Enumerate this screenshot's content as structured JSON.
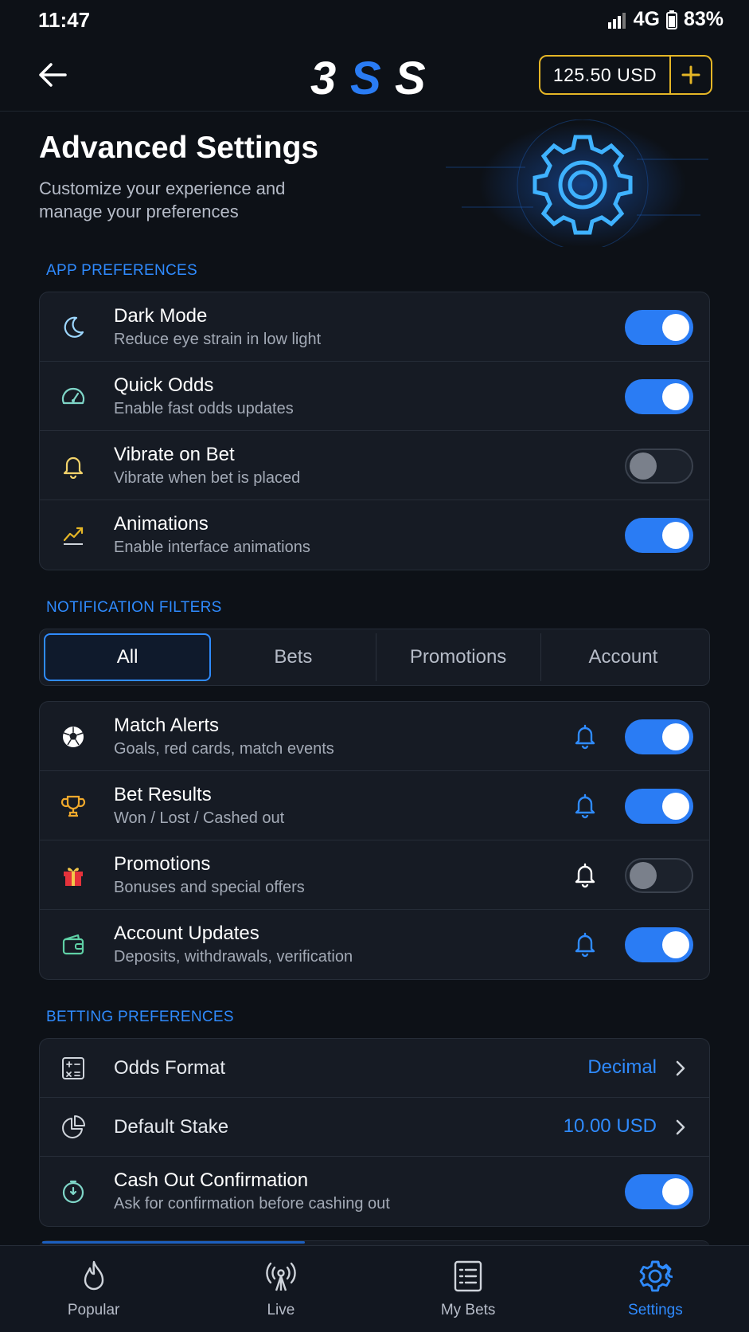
{
  "status": {
    "time": "11:47",
    "network": "4G",
    "battery": "83%"
  },
  "header": {
    "logo": "3SS",
    "balance": "125.50 USD"
  },
  "hero": {
    "title": "Advanced Settings",
    "subtitle_line1": "Customize your experience and",
    "subtitle_line2": "manage your preferences"
  },
  "app_preferences": {
    "label": "APP PREFERENCES",
    "items": [
      {
        "title": "Dark Mode",
        "subtitle": "Reduce eye strain in low light",
        "enabled": true
      },
      {
        "title": "Quick Odds",
        "subtitle": "Enable fast odds updates",
        "enabled": true
      },
      {
        "title": "Vibrate on Bet",
        "subtitle": "Vibrate when bet is placed",
        "enabled": false
      },
      {
        "title": "Animations",
        "subtitle": "Enable interface animations",
        "enabled": true
      }
    ]
  },
  "notification_filters": {
    "label": "NOTIFICATION FILTERS",
    "tabs": [
      "All",
      "Bets",
      "Promotions",
      "Account"
    ],
    "active_tab": "All",
    "items": [
      {
        "title": "Match Alerts",
        "subtitle": "Goals, red cards, match events",
        "enabled": true
      },
      {
        "title": "Bet Results",
        "subtitle": "Won / Lost / Cashed out",
        "enabled": true
      },
      {
        "title": "Promotions",
        "subtitle": "Bonuses and special offers",
        "enabled": false
      },
      {
        "title": "Account Updates",
        "subtitle": "Deposits, withdrawals, verification",
        "enabled": true
      }
    ]
  },
  "betting_preferences": {
    "label": "BETTING PREFERENCES",
    "odds_format": {
      "title": "Odds Format",
      "value": "Decimal"
    },
    "default_stake": {
      "title": "Default Stake",
      "value": "10.00 USD"
    },
    "cash_out": {
      "title": "Cash Out Confirmation",
      "subtitle": "Ask for confirmation before cashing out",
      "enabled": true
    }
  },
  "bottom_nav": [
    {
      "label": "Popular",
      "icon": "flame-icon"
    },
    {
      "label": "Live",
      "icon": "broadcast-icon"
    },
    {
      "label": "My Bets",
      "icon": "receipt-icon"
    },
    {
      "label": "Settings",
      "icon": "gear-icon"
    }
  ],
  "colors": {
    "accent": "#2f8bff",
    "toggle_on": "#2a7cf4",
    "gold": "#e5b626",
    "background": "#0d1117"
  }
}
